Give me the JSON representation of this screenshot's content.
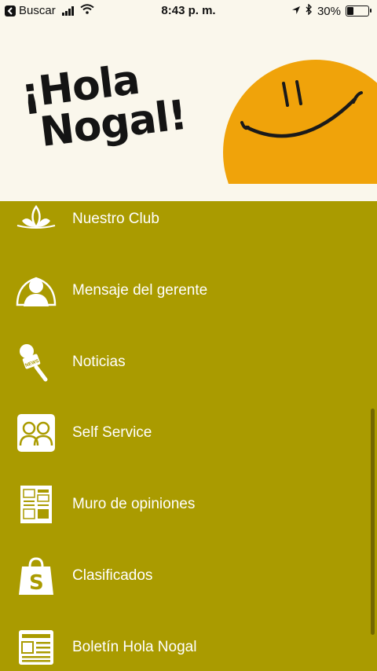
{
  "status_bar": {
    "back_label": "Buscar",
    "time": "8:43 p. m.",
    "battery": "30%",
    "battery_level": 0.3
  },
  "banner": {
    "greeting_line1": "¡Hola",
    "greeting_line2": "Nogal!",
    "accent_color": "#f0a30a"
  },
  "menu": {
    "background_color": "#aa9b00",
    "items": [
      {
        "label": "Nuestro Club",
        "icon": "club-emblem-icon"
      },
      {
        "label": "Mensaje del gerente",
        "icon": "manager-icon"
      },
      {
        "label": "Noticias",
        "icon": "microphone-icon"
      },
      {
        "label": "Self Service",
        "icon": "people-icon"
      },
      {
        "label": "Muro de opiniones",
        "icon": "bulletin-board-icon"
      },
      {
        "label": "Clasificados",
        "icon": "shopping-bag-icon"
      },
      {
        "label": "Boletín Hola Nogal",
        "icon": "newsletter-icon"
      }
    ]
  }
}
